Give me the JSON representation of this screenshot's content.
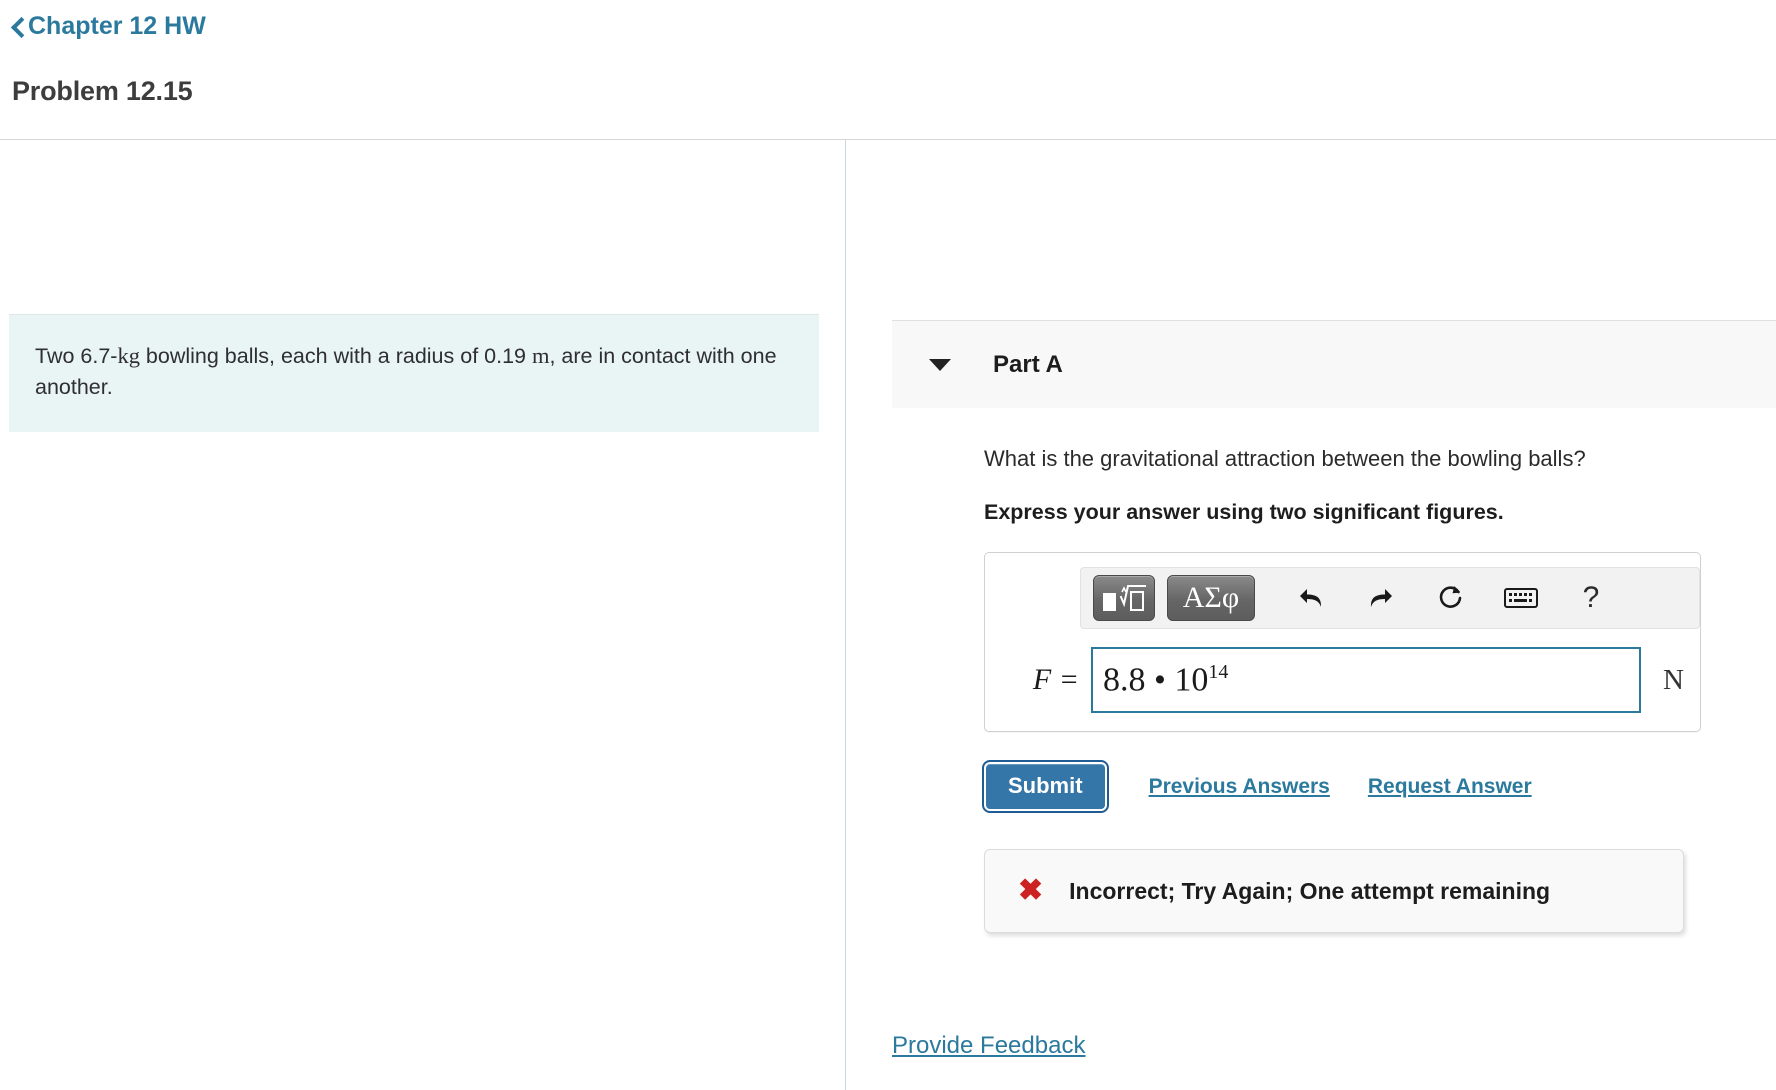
{
  "header": {
    "breadcrumb_label": "Chapter 12 HW",
    "back_icon": "chevron-left-icon",
    "problem_title": "Problem 12.15"
  },
  "problem": {
    "text_part1": "Two 6.7-",
    "unit_kg": "kg",
    "text_part2": " bowling balls, each with a radius of 0.19 ",
    "unit_m": "m",
    "text_part3": ", are in contact with one another."
  },
  "part": {
    "collapse_icon": "caret-down-icon",
    "label": "Part A",
    "question": "What is the gravitational attraction between the bowling balls?",
    "instruction": "Express your answer using two significant figures."
  },
  "math_toolbar": {
    "template_button": {
      "name": "math-template-button",
      "glyph": "■√□"
    },
    "greek_button": {
      "name": "greek-symbols-button",
      "label": "ΑΣφ"
    },
    "undo_icon": "undo-arrow-icon",
    "redo_icon": "redo-arrow-icon",
    "reset_icon": "reset-circular-arrow-icon",
    "keyboard_icon": "keyboard-icon",
    "help_label": "?"
  },
  "answer": {
    "variable": "F =",
    "value_mantissa": "8.8 • 10",
    "value_exponent": "14",
    "unit": "N",
    "placeholder": ""
  },
  "actions": {
    "submit_label": "Submit",
    "previous_answers_label": "Previous Answers",
    "request_answer_label": "Request Answer"
  },
  "result": {
    "icon": "red-x-icon",
    "icon_glyph": "✖",
    "message": "Incorrect; Try Again; One attempt remaining"
  },
  "footer": {
    "feedback_label": "Provide Feedback"
  },
  "colors": {
    "link_blue": "#2b7a9e",
    "submit_blue": "#3576a8",
    "statement_bg": "#e9f4f5",
    "error_red": "#cc2222",
    "input_focus_border": "#2b7a9e"
  }
}
